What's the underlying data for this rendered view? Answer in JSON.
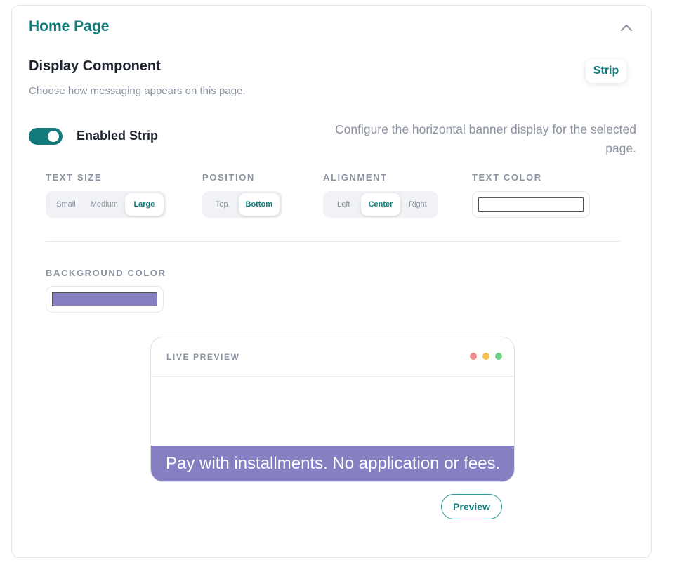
{
  "section": {
    "title": "Home Page"
  },
  "display_component": {
    "title": "Display Component",
    "subtitle": "Choose how messaging appears on this page.",
    "badge": "Strip"
  },
  "toggle": {
    "enabled": true,
    "label_word1": "Enabled",
    "label_word2": "Strip",
    "description": "Configure the horizontal banner display for the selected page."
  },
  "text_size": {
    "label": "TEXT SIZE",
    "options": [
      "Small",
      "Medium",
      "Large"
    ],
    "selected": "Large"
  },
  "position": {
    "label": "POSITION",
    "options": [
      "Top",
      "Bottom"
    ],
    "selected": "Bottom"
  },
  "alignment": {
    "label": "ALIGNMENT",
    "options": [
      "Left",
      "Center",
      "Right"
    ],
    "selected": "Center"
  },
  "text_color": {
    "label": "TEXT COLOR",
    "value": "#ffffff"
  },
  "background_color": {
    "label": "BACKGROUND COLOR",
    "value": "#8680c2"
  },
  "preview": {
    "title": "LIVE PREVIEW",
    "banner_text": "Pay with installments. No application or fees.",
    "button": "Preview",
    "dot_colors": [
      "#ee8a8a",
      "#f2c14e",
      "#6ccf84"
    ]
  },
  "colors": {
    "accent": "#127a7a",
    "muted": "#8b93a1"
  }
}
